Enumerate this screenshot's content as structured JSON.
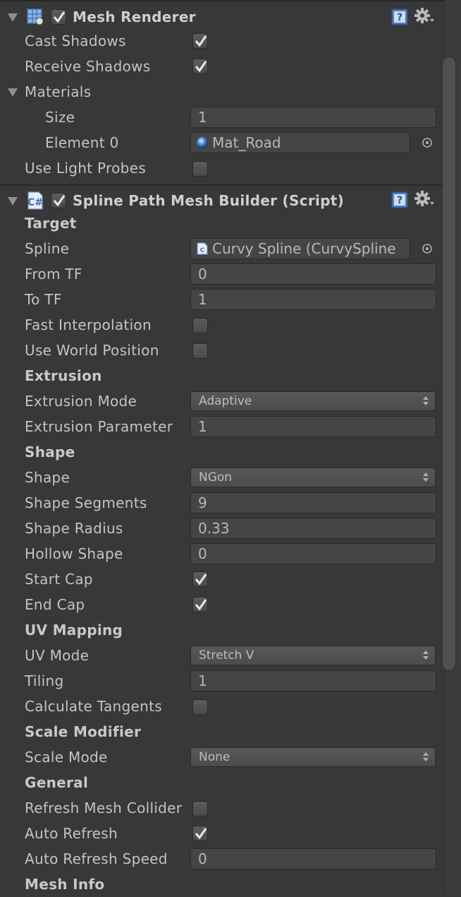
{
  "mesh_renderer": {
    "title": "Mesh Renderer",
    "enabled": true,
    "cast_shadows_label": "Cast Shadows",
    "cast_shadows": true,
    "receive_shadows_label": "Receive Shadows",
    "receive_shadows": true,
    "materials_label": "Materials",
    "size_label": "Size",
    "size_value": "1",
    "element0_label": "Element 0",
    "element0_value": "Mat_Road",
    "use_light_probes_label": "Use Light Probes",
    "use_light_probes": false
  },
  "spline_builder": {
    "title": "Spline Path Mesh Builder (Script)",
    "enabled": true,
    "target_header": "Target",
    "spline_label": "Spline",
    "spline_value": "Curvy Spline (CurvySpline",
    "from_tf_label": "From TF",
    "from_tf_value": "0",
    "to_tf_label": "To TF",
    "to_tf_value": "1",
    "fast_interp_label": "Fast Interpolation",
    "fast_interp": false,
    "use_world_pos_label": "Use World Position",
    "use_world_pos": false,
    "extrusion_header": "Extrusion",
    "extrusion_mode_label": "Extrusion Mode",
    "extrusion_mode_value": "Adaptive",
    "extrusion_param_label": "Extrusion Parameter",
    "extrusion_param_value": "1",
    "shape_header": "Shape",
    "shape_label": "Shape",
    "shape_value": "NGon",
    "shape_segments_label": "Shape Segments",
    "shape_segments_value": "9",
    "shape_radius_label": "Shape Radius",
    "shape_radius_value": "0.33",
    "hollow_shape_label": "Hollow Shape",
    "hollow_shape_value": "0",
    "start_cap_label": "Start Cap",
    "start_cap": true,
    "end_cap_label": "End Cap",
    "end_cap": true,
    "uv_header": "UV Mapping",
    "uv_mode_label": "UV Mode",
    "uv_mode_value": "Stretch V",
    "tiling_label": "Tiling",
    "tiling_value": "1",
    "calc_tangents_label": "Calculate Tangents",
    "calc_tangents": false,
    "scale_header": "Scale Modifier",
    "scale_mode_label": "Scale Mode",
    "scale_mode_value": "None",
    "general_header": "General",
    "refresh_collider_label": "Refresh Mesh Collider",
    "refresh_collider": false,
    "auto_refresh_label": "Auto Refresh",
    "auto_refresh": true,
    "auto_refresh_speed_label": "Auto Refresh Speed",
    "auto_refresh_speed_value": "0",
    "mesh_info_header": "Mesh Info"
  },
  "icons": {
    "mesh_renderer": "mesh-renderer-icon",
    "script": "csharp-script-icon",
    "help": "help-book-icon",
    "settings": "gear-icon",
    "foldout": "triangle-down-icon",
    "object_picker": "object-picker-icon",
    "material": "material-sphere-icon"
  },
  "colors": {
    "background": "#383838",
    "field_background": "#454545",
    "text": "#c4c4c4",
    "help_icon": "#5b8fd0"
  }
}
